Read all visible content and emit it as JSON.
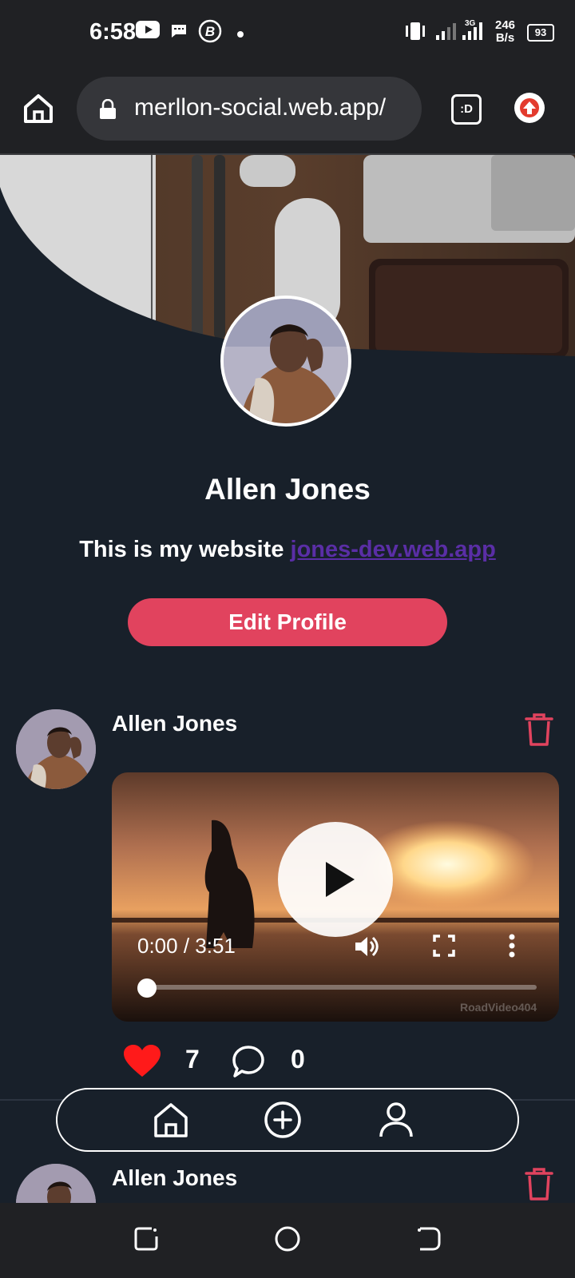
{
  "status_bar": {
    "time": "6:58",
    "network_speed_value": "246",
    "network_speed_unit": "B/s",
    "battery": "93",
    "icons": [
      "youtube-icon",
      "message-icon",
      "b-app-icon",
      "dot-icon",
      "vibrate-icon",
      "signal-icon",
      "signal-3g-icon",
      "battery-icon"
    ]
  },
  "browser": {
    "url": "merllon-social.web.app/",
    "tab_label": ":D",
    "icons": [
      "home-icon",
      "lock-icon",
      "tab-switcher-icon",
      "upload-extension-icon"
    ]
  },
  "profile": {
    "name": "Allen Jones",
    "bio_text": "This is my website ",
    "bio_link": "jones-dev.web.app",
    "edit_button": "Edit Profile"
  },
  "posts": [
    {
      "author": "Allen Jones",
      "video": {
        "time": "0:00 / 3:51",
        "watermark": "RoadVideo404",
        "progress": 0
      },
      "likes": "7",
      "comments": "0"
    },
    {
      "author": "Allen Jones"
    }
  ],
  "bottom_nav": {
    "items": [
      "home-icon",
      "add-post-icon",
      "profile-icon"
    ]
  },
  "colors": {
    "background": "#18202a",
    "accent": "#e1435e",
    "link": "#5a2ea6",
    "like": "#ff1a1a",
    "browser_chrome": "#202124"
  }
}
